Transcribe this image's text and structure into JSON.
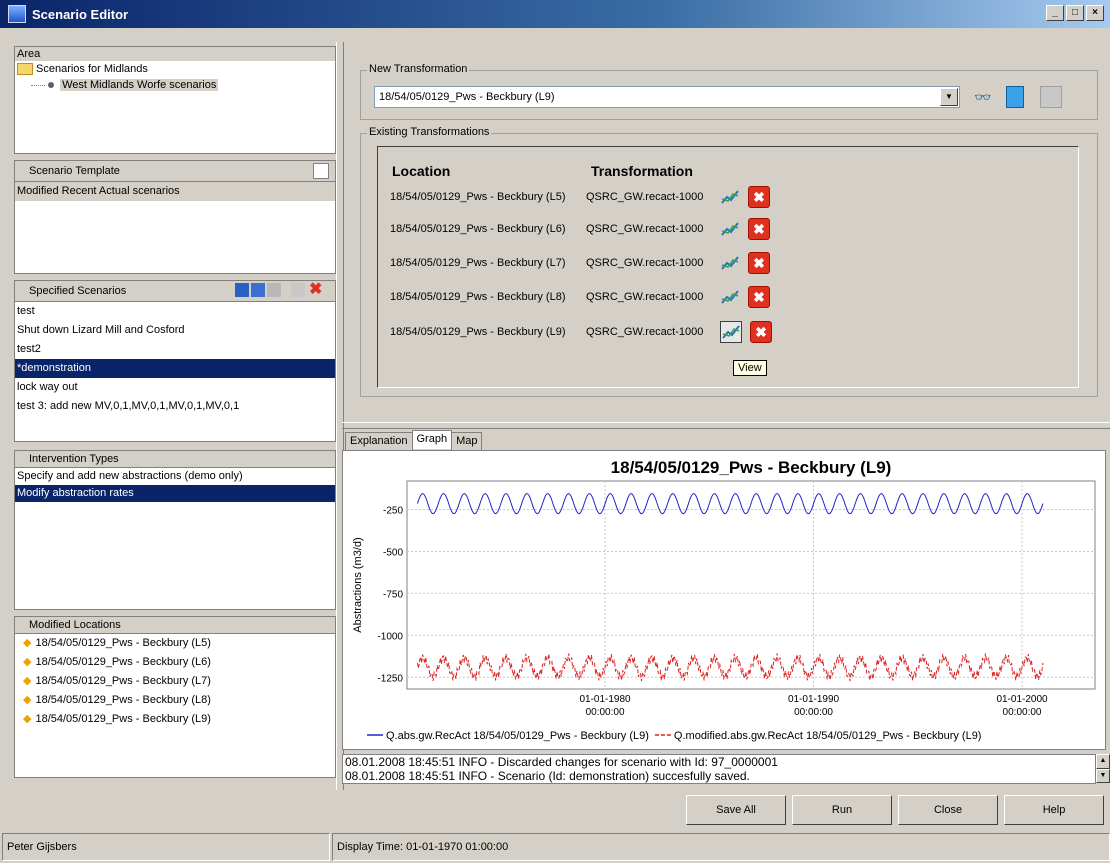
{
  "window": {
    "title": "Scenario Editor"
  },
  "area": {
    "header": "Area",
    "root": "Scenarios for Midlands",
    "child": "West Midlands Worfe scenarios"
  },
  "template": {
    "header": "Scenario Template",
    "items": [
      "Modified Recent Actual scenarios"
    ]
  },
  "scenarios": {
    "header": "Specified Scenarios",
    "items": [
      "test",
      "Shut down Lizard Mill and Cosford",
      "test2",
      "*demonstration",
      "lock way out",
      "test 3: add new MV,0,1,MV,0,1,MV,0,1,MV,0,1"
    ],
    "selected_index": 3
  },
  "interventions": {
    "header": "Intervention Types",
    "items": [
      "Specify and add new abstractions (demo only)",
      "Modify abstraction rates"
    ],
    "selected_index": 1
  },
  "modified_locations": {
    "header": "Modified Locations",
    "items": [
      "18/54/05/0129_Pws - Beckbury (L5)",
      "18/54/05/0129_Pws - Beckbury (L6)",
      "18/54/05/0129_Pws - Beckbury (L7)",
      "18/54/05/0129_Pws - Beckbury (L8)",
      "18/54/05/0129_Pws - Beckbury (L9)"
    ]
  },
  "new_transformation": {
    "label": "New Transformation",
    "selected": "18/54/05/0129_Pws - Beckbury (L9)"
  },
  "existing": {
    "label": "Existing Transformations",
    "col_location": "Location",
    "col_transformation": "Transformation",
    "rows": [
      {
        "location": "18/54/05/0129_Pws - Beckbury (L5)",
        "transformation": "QSRC_GW.recact-1000"
      },
      {
        "location": "18/54/05/0129_Pws - Beckbury (L6)",
        "transformation": "QSRC_GW.recact-1000"
      },
      {
        "location": "18/54/05/0129_Pws - Beckbury (L7)",
        "transformation": "QSRC_GW.recact-1000"
      },
      {
        "location": "18/54/05/0129_Pws - Beckbury (L8)",
        "transformation": "QSRC_GW.recact-1000"
      },
      {
        "location": "18/54/05/0129_Pws - Beckbury (L9)",
        "transformation": "QSRC_GW.recact-1000"
      }
    ],
    "tooltip": "View"
  },
  "tabs": {
    "explanation": "Explanation",
    "graph": "Graph",
    "map": "Map",
    "active": "Graph"
  },
  "chart_data": {
    "type": "line",
    "title": "18/54/05/0129_Pws - Beckbury (L9)",
    "ylabel": "Abstractions (m3/d)",
    "xlabel": "",
    "x_ticks": [
      "01-01-1980\n00:00:00",
      "01-01-1990\n00:00:00",
      "01-01-2000\n00:00:00"
    ],
    "y_ticks": [
      -250,
      -500,
      -750,
      -1000,
      -1250
    ],
    "ylim": [
      -1320,
      -80
    ],
    "xlim_years": [
      1970.5,
      2003.5
    ],
    "grid": true,
    "legend_position": "bottom",
    "series": [
      {
        "name": "Q.abs.gw.RecAct 18/54/05/0129_Pws - Beckbury (L9)",
        "color": "#2222cc",
        "style": "solid",
        "x_years": [
          1971,
          2001
        ],
        "mean": -215,
        "amplitude": 60,
        "cycles_per_year": 1
      },
      {
        "name": "Q.modified.abs.gw.RecAct 18/54/05/0129_Pws - Beckbury (L9)",
        "color": "#dd2222",
        "style": "dashed",
        "x_years": [
          1971,
          2001
        ],
        "mean": -1190,
        "amplitude": 55,
        "cycles_per_year": 1
      }
    ]
  },
  "log": {
    "lines": [
      "08.01.2008 18:45:51 INFO - Discarded changes for scenario with Id: 97_0000001",
      "08.01.2008 18:45:51 INFO - Scenario (Id: demonstration) succesfully saved."
    ]
  },
  "buttons": {
    "save_all": "Save All",
    "run": "Run",
    "close": "Close",
    "help": "Help"
  },
  "status": {
    "user": "Peter Gijsbers",
    "display_time": "Display Time: 01-01-1970 01:00:00"
  }
}
